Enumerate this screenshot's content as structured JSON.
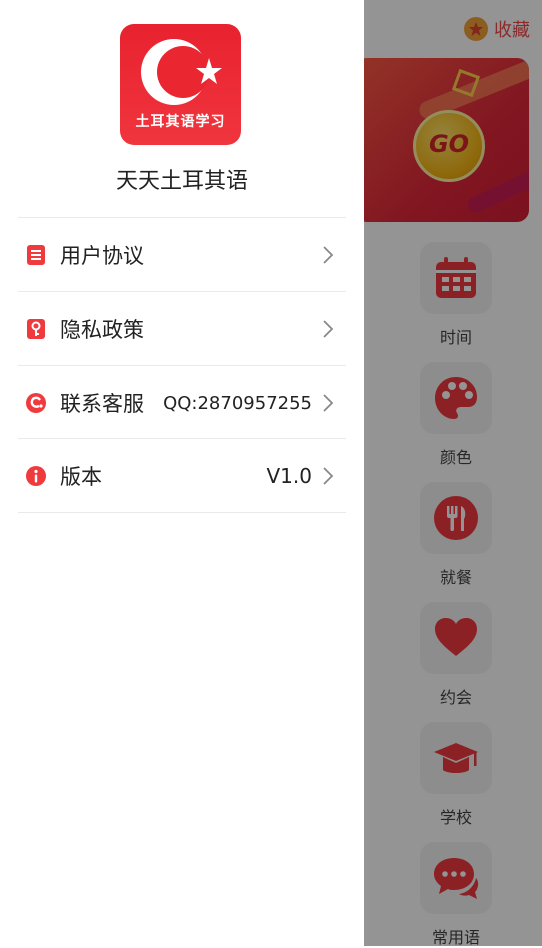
{
  "background": {
    "favorite_label": "收藏",
    "banner_button_text": "GO",
    "categories": [
      {
        "label": "时间",
        "icon": "calendar-icon"
      },
      {
        "label": "颜色",
        "icon": "palette-icon"
      },
      {
        "label": "就餐",
        "icon": "cutlery-icon"
      },
      {
        "label": "约会",
        "icon": "heart-icon"
      },
      {
        "label": "学校",
        "icon": "graduation-cap-icon"
      },
      {
        "label": "常用语",
        "icon": "chat-bubbles-icon"
      }
    ]
  },
  "drawer": {
    "logo_text": "土耳其语学习",
    "app_name": "天天土耳其语",
    "menu": [
      {
        "label": "用户协议",
        "value": "",
        "icon": "document-icon"
      },
      {
        "label": "隐私政策",
        "value": "",
        "icon": "privacy-lock-icon"
      },
      {
        "label": "联系客服",
        "value": "QQ:2870957255",
        "icon": "customer-service-icon"
      },
      {
        "label": "版本",
        "value": "V1.0",
        "icon": "info-icon"
      }
    ]
  },
  "colors": {
    "accent": "#ef3a3e",
    "banner": "#e0283a",
    "favorite_star": "#f2a03a"
  }
}
